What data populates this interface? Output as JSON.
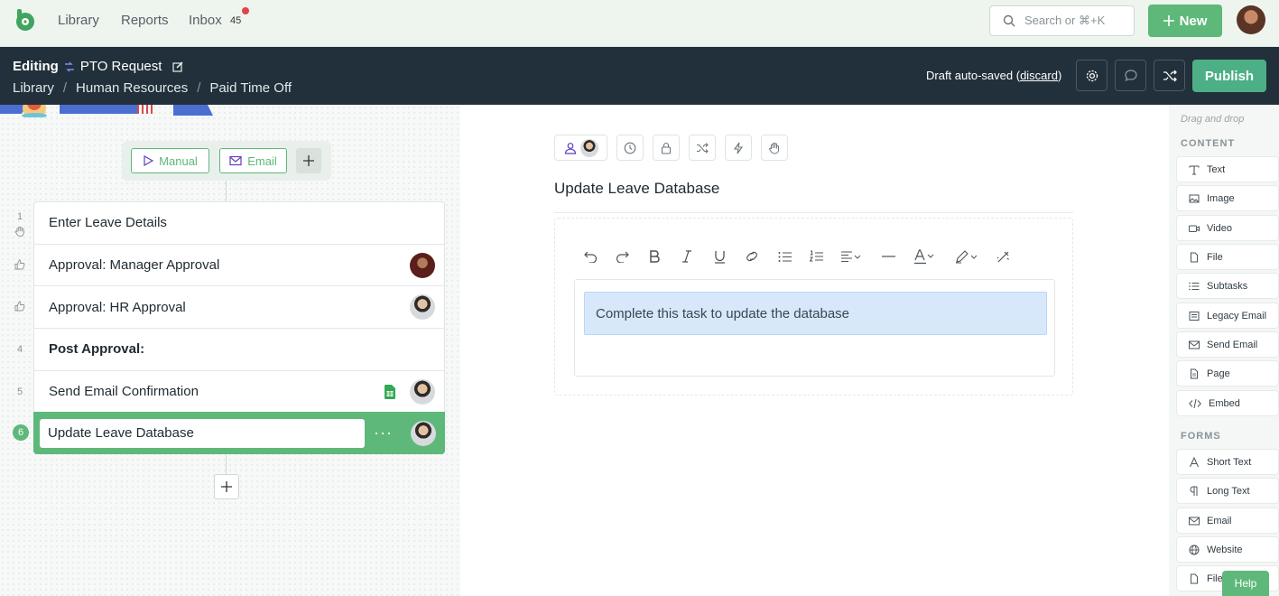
{
  "topnav": {
    "links": [
      "Library",
      "Reports",
      "Inbox"
    ],
    "inbox_count": "45",
    "search_placeholder": "Search or ⌘+K",
    "new_label": "New"
  },
  "header": {
    "mode": "Editing",
    "workflow_name": "PTO Request",
    "breadcrumb": [
      "Library",
      "Human Resources",
      "Paid Time Off"
    ],
    "draft_text": "Draft auto-saved",
    "discard_label": "discard",
    "publish_label": "Publish"
  },
  "triggers": {
    "manual_label": "Manual",
    "email_label": "Email"
  },
  "steps": [
    {
      "number": "1",
      "label": "Enter Leave Details"
    },
    {
      "number": "",
      "label": "Approval: Manager Approval"
    },
    {
      "number": "",
      "label": "Approval: HR Approval"
    },
    {
      "number": "4",
      "label": "Post Approval:"
    },
    {
      "number": "5",
      "label": "Send Email Confirmation"
    },
    {
      "number": "6",
      "label": "Update Leave Database"
    }
  ],
  "task": {
    "title": "Update Leave Database",
    "callout_text": "Complete this task to update the database"
  },
  "sidebar": {
    "hint": "Drag and drop",
    "content_heading": "CONTENT",
    "content_items": [
      "Text",
      "Image",
      "Video",
      "File",
      "Subtasks",
      "Legacy Email",
      "Send Email",
      "Page",
      "Embed"
    ],
    "forms_heading": "FORMS",
    "form_items": [
      "Short Text",
      "Long Text",
      "Email",
      "Website",
      "File"
    ]
  },
  "help_label": "Help",
  "colors": {
    "brand_green": "#5eb87a",
    "publish_green": "#4caf86",
    "header_dark": "#21303a",
    "callout_blue": "#d8e8fb"
  }
}
